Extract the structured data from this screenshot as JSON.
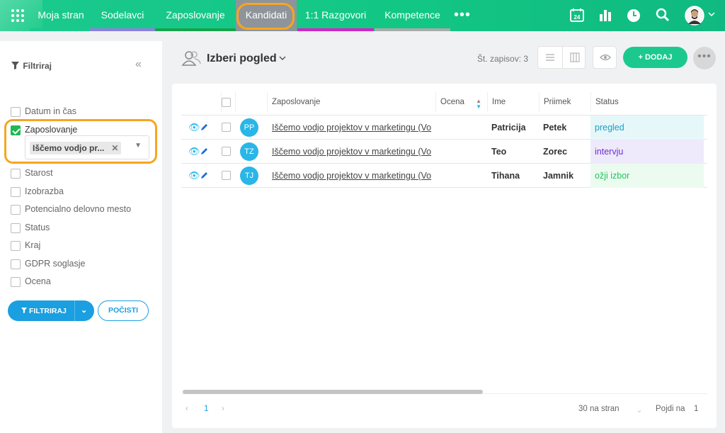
{
  "nav": {
    "items": [
      {
        "label": "Moja stran",
        "color": "#1bc98e"
      },
      {
        "label": "Sodelavci",
        "color": "#8e7fe0"
      },
      {
        "label": "Zaposlovanje",
        "color": "#17a34a"
      },
      {
        "label": "Kandidati",
        "color": "#8e9499"
      },
      {
        "label": "1:1 Razgovori",
        "color": "#d821c9"
      },
      {
        "label": "Kompetence",
        "color": "#aaaaaa"
      }
    ],
    "more": "•••",
    "calendar_day": "24"
  },
  "sidebar": {
    "title": "Filtriraj",
    "filters": [
      {
        "label": "Datum in čas",
        "checked": false
      },
      {
        "label": "Zaposlovanje",
        "checked": true
      },
      {
        "label": "Starost",
        "checked": false
      },
      {
        "label": "Izobrazba",
        "checked": false
      },
      {
        "label": "Potencialno delovno mesto",
        "checked": false
      },
      {
        "label": "Status",
        "checked": false
      },
      {
        "label": "Kraj",
        "checked": false
      },
      {
        "label": "GDPR soglasje",
        "checked": false
      },
      {
        "label": "Ocena",
        "checked": false
      }
    ],
    "chip": "Iščemo vodjo pr...",
    "filter_button": "FILTRIRAJ",
    "clear_button": "POČISTI"
  },
  "header": {
    "view_title": "Izberi pogled",
    "records": "Št. zapisov: 3",
    "add_button": "DODAJ"
  },
  "table": {
    "columns": [
      "Zaposlovanje",
      "Ocena",
      "Ime",
      "Priimek",
      "Status"
    ],
    "rows": [
      {
        "initials": "PP",
        "job": "Iščemo vodjo projektov v marketingu (Vo",
        "ime": "Patricija",
        "priimek": "Petek",
        "status": "pregled",
        "status_color": "#1aa0c8",
        "status_bg": "#e6f7f9"
      },
      {
        "initials": "TZ",
        "job": "Iščemo vodjo projektov v marketingu (Vo",
        "ime": "Teo",
        "priimek": "Zorec",
        "status": "intervju",
        "status_color": "#6b2fd1",
        "status_bg": "#eeeafb"
      },
      {
        "initials": "TJ",
        "job": "Iščemo vodjo projektov v marketingu (Vo",
        "ime": "Tihana",
        "priimek": "Jamnik",
        "status": "ožji izbor",
        "status_color": "#22c55e",
        "status_bg": "#ecfbf0"
      }
    ]
  },
  "pagination": {
    "page": "1",
    "per_page": "30 na stran",
    "goto_label": "Pojdi na",
    "goto_value": "1"
  }
}
